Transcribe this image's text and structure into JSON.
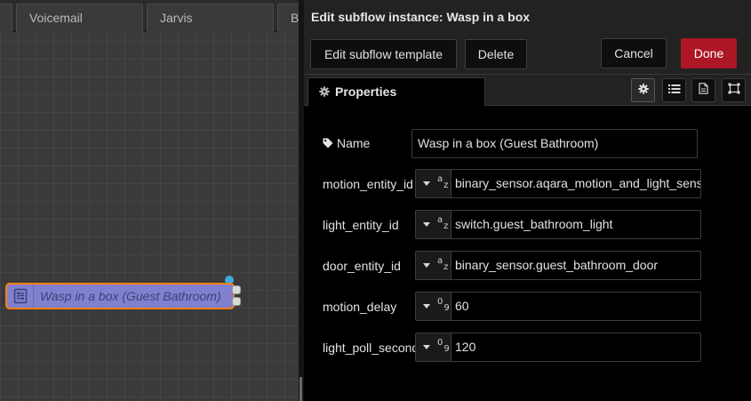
{
  "workspace": {
    "tabs": [
      {
        "label": ""
      },
      {
        "label": "Voicemail"
      },
      {
        "label": "Jarvis"
      },
      {
        "label": "B"
      }
    ],
    "node": {
      "label": "Wasp in a box (Guest Bathroom)",
      "fill_color": "#8080cf",
      "selected_border_color": "#ff7f0e",
      "icon": "subflow-icon"
    }
  },
  "tray": {
    "title": "Edit subflow instance: Wasp in a box",
    "toolbar": {
      "edit_template_label": "Edit subflow template",
      "delete_label": "Delete",
      "cancel_label": "Cancel",
      "done_label": "Done",
      "done_color": "#ad1625"
    },
    "tabs": {
      "properties_label": "Properties",
      "icons": [
        "gear-icon",
        "list-icon",
        "document-icon",
        "frame-icon"
      ]
    },
    "form": {
      "name_label": "Name",
      "name_value": "Wasp in a box (Guest Bathroom)",
      "fields": [
        {
          "label": "motion_entity_id",
          "type": "string",
          "type_glyph_top": "a",
          "type_glyph_bottom": "z",
          "value": "binary_sensor.aqara_motion_and_light_sens"
        },
        {
          "label": "light_entity_id",
          "type": "string",
          "type_glyph_top": "a",
          "type_glyph_bottom": "z",
          "value": "switch.guest_bathroom_light"
        },
        {
          "label": "door_entity_id",
          "type": "string",
          "type_glyph_top": "a",
          "type_glyph_bottom": "z",
          "value": "binary_sensor.guest_bathroom_door"
        },
        {
          "label": "motion_delay",
          "type": "number",
          "type_glyph_top": "0",
          "type_glyph_bottom": "9",
          "value": "60"
        },
        {
          "label": "light_poll_seconds",
          "type": "number",
          "type_glyph_top": "0",
          "type_glyph_bottom": "9",
          "value": "120"
        }
      ]
    }
  }
}
